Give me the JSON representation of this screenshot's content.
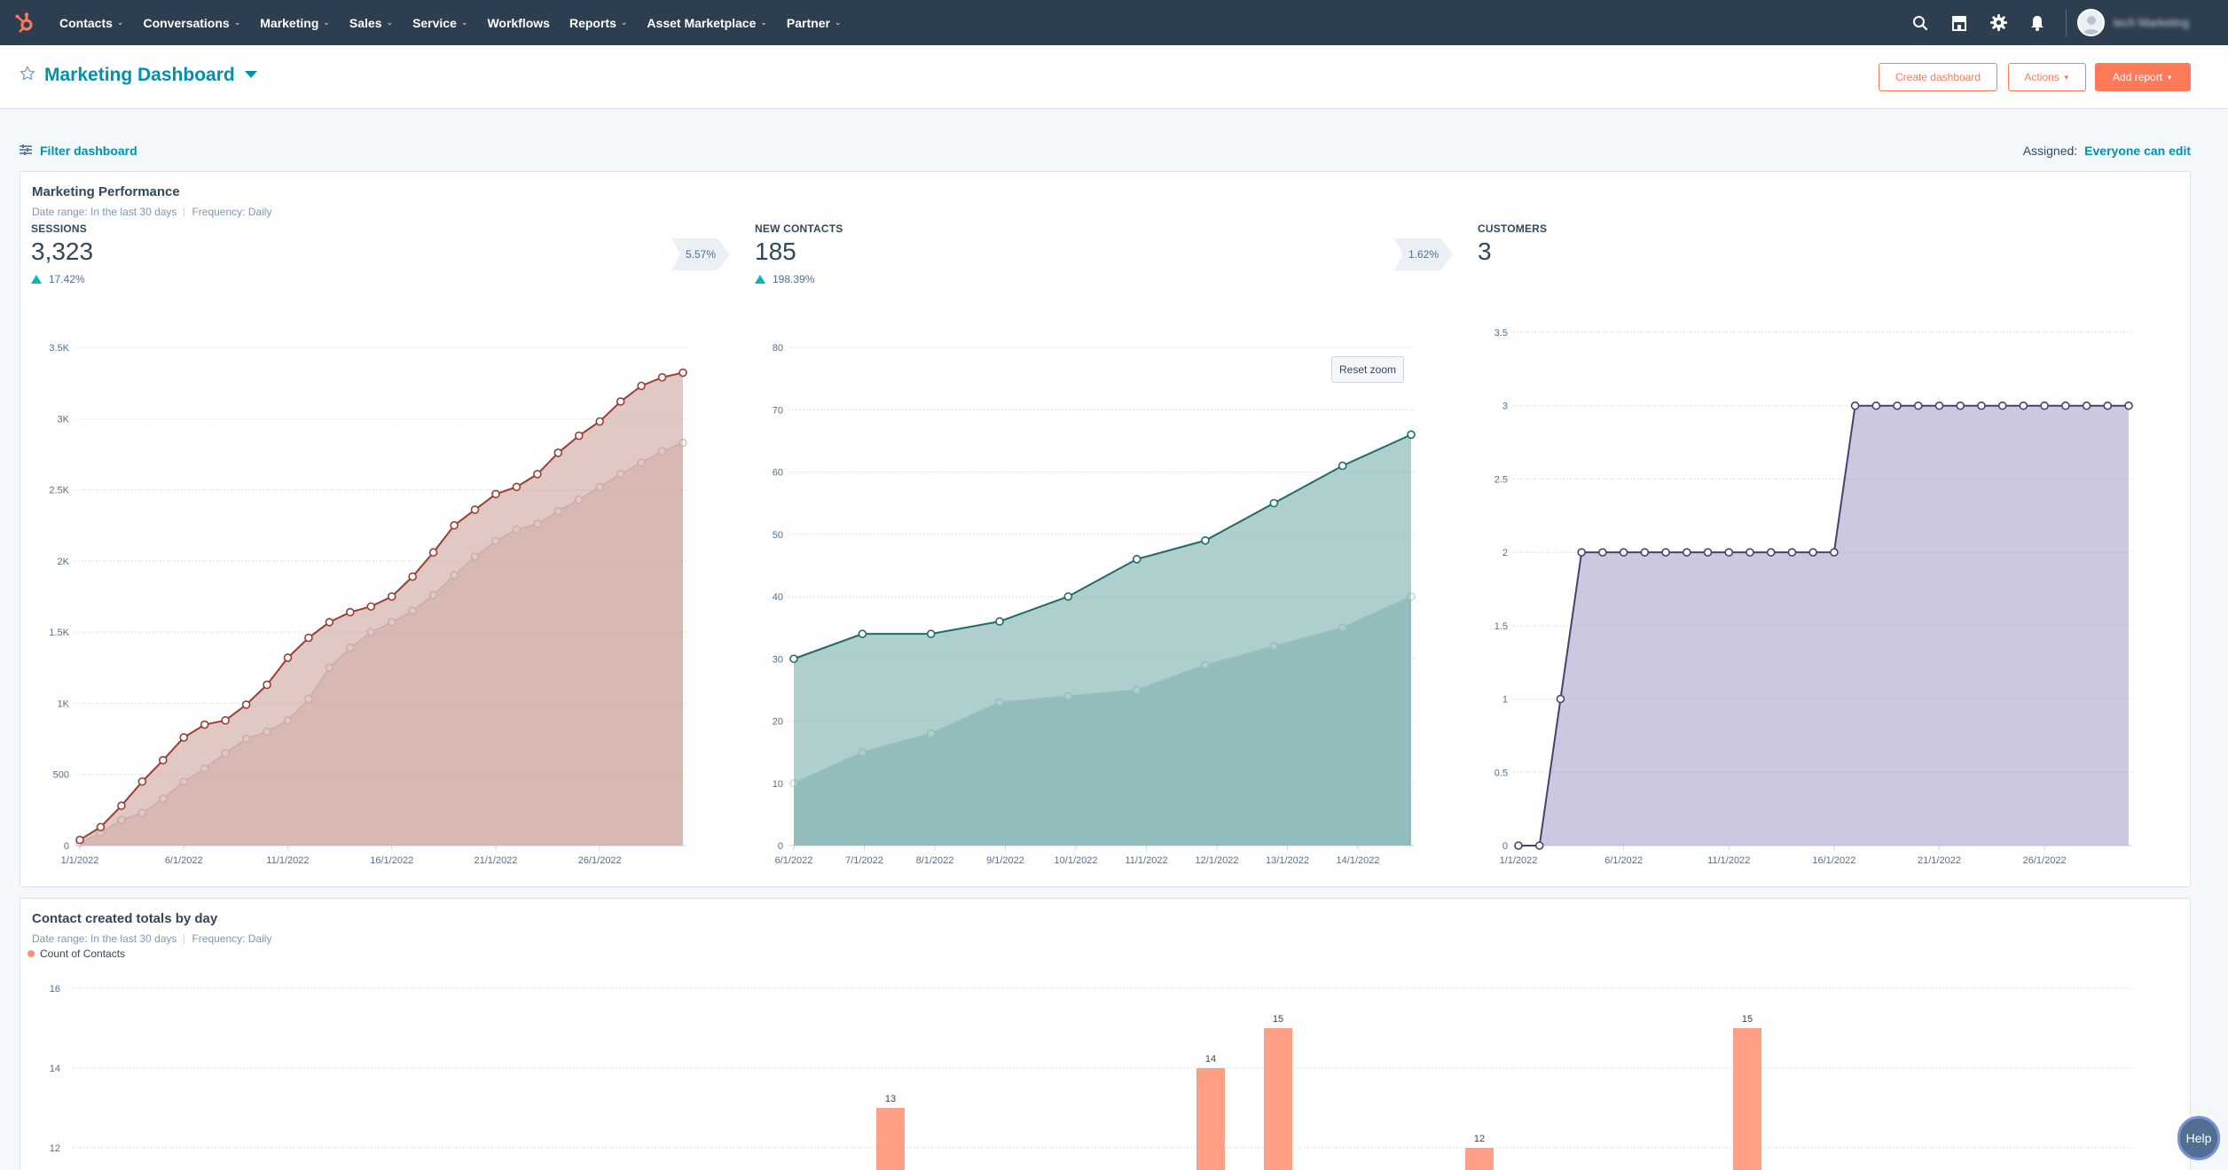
{
  "nav": {
    "items": [
      {
        "label": "Contacts",
        "dropdown": true
      },
      {
        "label": "Conversations",
        "dropdown": true
      },
      {
        "label": "Marketing",
        "dropdown": true
      },
      {
        "label": "Sales",
        "dropdown": true
      },
      {
        "label": "Service",
        "dropdown": true
      },
      {
        "label": "Workflows",
        "dropdown": false
      },
      {
        "label": "Reports",
        "dropdown": true
      },
      {
        "label": "Asset Marketplace",
        "dropdown": true
      },
      {
        "label": "Partner",
        "dropdown": true
      }
    ],
    "account_name": "tech Marketing"
  },
  "header": {
    "title": "Marketing Dashboard",
    "create_label": "Create dashboard",
    "actions_label": "Actions",
    "add_report_label": "Add report"
  },
  "filter": {
    "label": "Filter dashboard",
    "assigned_label": "Assigned:",
    "assigned_value": "Everyone can edit"
  },
  "perf_card": {
    "title": "Marketing Performance",
    "date_range": "Date range: In the last 30 days",
    "frequency": "Frequency: Daily",
    "kpis": [
      {
        "label": "SESSIONS",
        "value": "3,323",
        "change": "17.42%",
        "badge": "5.57%"
      },
      {
        "label": "NEW CONTACTS",
        "value": "185",
        "change": "198.39%",
        "badge": "1.62%"
      },
      {
        "label": "CUSTOMERS",
        "value": "3"
      }
    ],
    "reset_zoom_label": "Reset zoom"
  },
  "contacts_card": {
    "title": "Contact created totals by day",
    "date_range": "Date range: In the last 30 days",
    "frequency": "Frequency: Daily",
    "legend": "Count of Contacts"
  },
  "help_label": "Help",
  "colors": {
    "nav_bg": "#2d3e50",
    "accent": "#ff7a59",
    "link": "#0091ae",
    "sessions": "#a04a3e",
    "contacts": "#1f6b6b",
    "customers": "#4b3f72",
    "bar": "#ff9f85"
  },
  "chart_data": [
    {
      "type": "area",
      "title": "SESSIONS",
      "x": [
        "1/1/2022",
        "2/1/2022",
        "3/1/2022",
        "4/1/2022",
        "5/1/2022",
        "6/1/2022",
        "7/1/2022",
        "8/1/2022",
        "9/1/2022",
        "10/1/2022",
        "11/1/2022",
        "12/1/2022",
        "13/1/2022",
        "14/1/2022",
        "15/1/2022",
        "16/1/2022",
        "17/1/2022",
        "18/1/2022",
        "19/1/2022",
        "20/1/2022",
        "21/1/2022",
        "22/1/2022",
        "23/1/2022",
        "24/1/2022",
        "25/1/2022",
        "26/1/2022",
        "27/1/2022",
        "28/1/2022",
        "29/1/2022",
        "30/1/2022"
      ],
      "xticks": [
        "1/1/2022",
        "6/1/2022",
        "11/1/2022",
        "16/1/2022",
        "21/1/2022",
        "26/1/2022"
      ],
      "series": [
        {
          "values": [
            40,
            130,
            280,
            450,
            600,
            760,
            850,
            880,
            990,
            1130,
            1320,
            1460,
            1570,
            1640,
            1680,
            1750,
            1890,
            2060,
            2250,
            2360,
            2470,
            2520,
            2610,
            2760,
            2880,
            2980,
            3120,
            3230,
            3290,
            3323
          ]
        },
        {
          "values": [
            20,
            90,
            180,
            230,
            330,
            450,
            540,
            650,
            750,
            800,
            880,
            1030,
            1250,
            1390,
            1500,
            1570,
            1650,
            1760,
            1900,
            2030,
            2140,
            2220,
            2260,
            2350,
            2430,
            2520,
            2610,
            2690,
            2770,
            2830
          ]
        }
      ],
      "yticks": [
        0,
        500,
        1000,
        1500,
        2000,
        2500,
        3000,
        3500
      ],
      "ytick_labels": [
        "0",
        "500",
        "1K",
        "1.5K",
        "2K",
        "2.5K",
        "3K",
        "3.5K"
      ],
      "ylim": [
        0,
        3500
      ]
    },
    {
      "type": "area",
      "title": "NEW CONTACTS",
      "x": [
        "6/1/2022",
        "7/1/2022",
        "8/1/2022",
        "9/1/2022",
        "10/1/2022",
        "11/1/2022",
        "12/1/2022",
        "13/1/2022",
        "14/1/2022"
      ],
      "xticks": [
        "6/1/2022",
        "7/1/2022",
        "8/1/2022",
        "9/1/2022",
        "10/1/2022",
        "11/1/2022",
        "12/1/2022",
        "13/1/2022",
        "14/1/2022"
      ],
      "series": [
        {
          "values": [
            30,
            34,
            34,
            36,
            40,
            46,
            49,
            55,
            61,
            66
          ]
        },
        {
          "values": [
            10,
            15,
            18,
            23,
            24,
            25,
            29,
            32,
            35,
            40
          ]
        }
      ],
      "yticks": [
        0,
        10,
        20,
        30,
        40,
        50,
        60,
        70,
        80
      ],
      "ylim": [
        0,
        80
      ]
    },
    {
      "type": "area",
      "title": "CUSTOMERS",
      "x": [
        "1/1/2022",
        "2/1/2022",
        "3/1/2022",
        "4/1/2022",
        "5/1/2022",
        "6/1/2022",
        "7/1/2022",
        "8/1/2022",
        "9/1/2022",
        "10/1/2022",
        "11/1/2022",
        "12/1/2022",
        "13/1/2022",
        "14/1/2022",
        "15/1/2022",
        "16/1/2022",
        "17/1/2022",
        "18/1/2022",
        "19/1/2022",
        "20/1/2022",
        "21/1/2022",
        "22/1/2022",
        "23/1/2022",
        "24/1/2022",
        "25/1/2022",
        "26/1/2022",
        "27/1/2022",
        "28/1/2022",
        "29/1/2022",
        "30/1/2022"
      ],
      "xticks": [
        "1/1/2022",
        "6/1/2022",
        "11/1/2022",
        "16/1/2022",
        "21/1/2022",
        "26/1/2022"
      ],
      "series": [
        {
          "values": [
            0,
            0,
            1,
            2,
            2,
            2,
            2,
            2,
            2,
            2,
            2,
            2,
            2,
            2,
            2,
            2,
            3,
            3,
            3,
            3,
            3,
            3,
            3,
            3,
            3,
            3,
            3,
            3,
            3,
            3
          ]
        }
      ],
      "yticks": [
        0,
        0.5,
        1,
        1.5,
        2,
        2.5,
        3,
        3.5
      ],
      "ylim": [
        0,
        3.5
      ]
    },
    {
      "type": "bar",
      "title": "Contact created totals by day",
      "series": [
        {
          "name": "Count of Contacts",
          "values": [
            13,
            14,
            15,
            12,
            15
          ]
        }
      ],
      "yticks": [
        12,
        14,
        16
      ],
      "ylim": [
        11,
        16
      ]
    }
  ]
}
